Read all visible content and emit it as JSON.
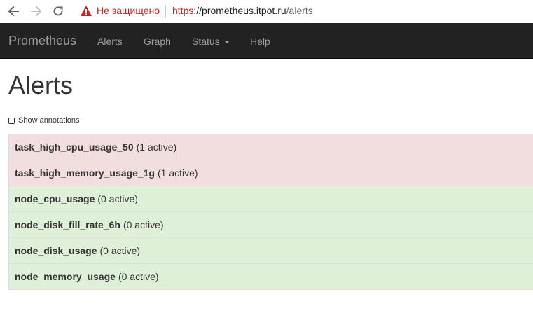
{
  "browser": {
    "security_text": "Не защищено",
    "url_scheme": "https",
    "url_host": "://prometheus.itpot.ru",
    "url_path": "/alerts",
    "icons": [
      "back-arrow-icon",
      "forward-arrow-icon",
      "reload-icon",
      "warning-icon"
    ],
    "warning_color": "#c5221f"
  },
  "navbar": {
    "brand": "Prometheus",
    "items": [
      {
        "label": "Alerts"
      },
      {
        "label": "Graph"
      },
      {
        "label": "Status"
      },
      {
        "label": "Help"
      }
    ],
    "background": "#222222",
    "text_color": "#9d9d9d"
  },
  "page": {
    "title": "Alerts",
    "show_annotations_label": "Show annotations",
    "show_annotations_checked": false
  },
  "alerts": [
    {
      "name": "task_high_cpu_usage_50",
      "count": "(1 active)",
      "state": "firing"
    },
    {
      "name": "task_high_memory_usage_1g",
      "count": "(1 active)",
      "state": "firing"
    },
    {
      "name": "node_cpu_usage",
      "count": "(0 active)",
      "state": "inactive"
    },
    {
      "name": "node_disk_fill_rate_6h",
      "count": "(0 active)",
      "state": "inactive"
    },
    {
      "name": "node_disk_usage",
      "count": "(0 active)",
      "state": "inactive"
    },
    {
      "name": "node_memory_usage",
      "count": "(0 active)",
      "state": "inactive"
    }
  ],
  "colors": {
    "firing_bg": "#f2dede",
    "inactive_bg": "#dff0d8"
  }
}
